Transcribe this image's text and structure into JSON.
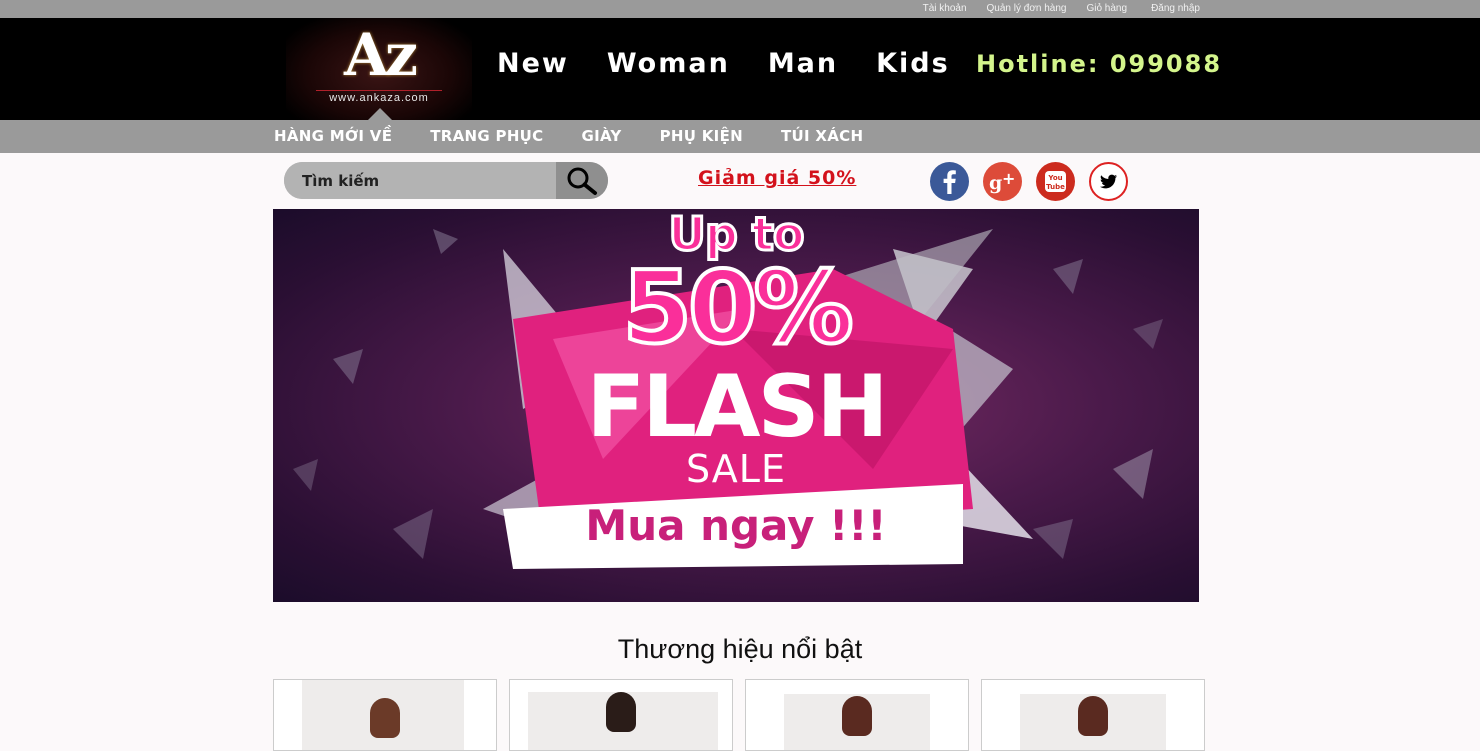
{
  "topbar": {
    "links": [
      "Tài khoản",
      "Quản lý đơn hàng",
      "Giỏ hàng",
      "Đăng nhập"
    ]
  },
  "logo": {
    "mark": "Az",
    "url": "www.ankaza.com"
  },
  "main_nav": [
    "New",
    "Woman",
    "Man",
    "Kids"
  ],
  "hotline": "Hotline: 099088",
  "categories": [
    "HÀNG MỚI VỀ",
    "TRANG PHỤC",
    "GIÀY",
    "PHỤ KIỆN",
    "TÚI XÁCH"
  ],
  "search": {
    "placeholder": "Tìm kiếm"
  },
  "promo_link": "Giảm giá 50%",
  "social": [
    "facebook-icon",
    "google-plus-icon",
    "youtube-icon",
    "twitter-icon"
  ],
  "banner": {
    "up_to": "Up to",
    "percent": "50%",
    "flash": "FLASH",
    "sale": "SALE",
    "cta": "Mua ngay !!!"
  },
  "brands_title": "Thương hiệu nổi bật",
  "colors": {
    "header_bg": "#000000",
    "bar_gray": "#9a9a9a",
    "hotline": "#d4f58c",
    "promo": "#d3121c",
    "banner_pink": "#fa2f9a"
  }
}
